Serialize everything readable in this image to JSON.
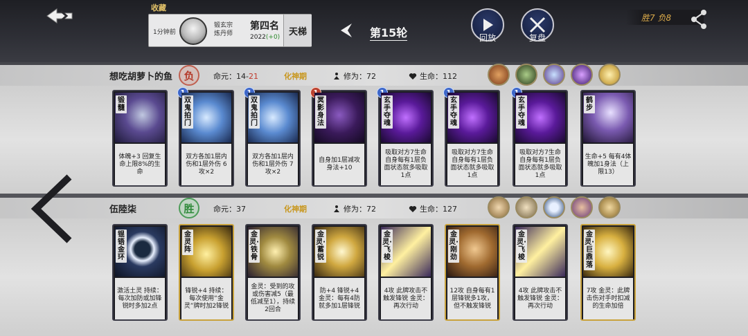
{
  "header": {
    "favorite_label": "收藏",
    "time_ago": "1分钟前",
    "sect_line1": "锻玄宗",
    "sect_line2": "炼丹师",
    "rank": "第四名",
    "score": "2022",
    "score_delta": "(+0)",
    "ladder": "天梯",
    "round": "第15轮",
    "replay_label": "回放",
    "review_label": "复盘",
    "record": "胜7  负8"
  },
  "players": [
    {
      "name": "想吃胡萝卜的鱼",
      "result": "负",
      "life_label": "命元：",
      "life_value": "14",
      "life_sep": "-",
      "life_loss": "21",
      "realm": "化神期",
      "cultivation_label": "修为：",
      "cultivation": "72",
      "hp_label": "生命：",
      "hp": "112",
      "skills": [
        "orange-beast-icon",
        "green-warrior-icon",
        "blue-sword-icon",
        "violet-lightning-icon",
        "golden-sun-icon"
      ],
      "cards": [
        {
          "name": "锻髓",
          "level": "",
          "desc": "体魄+3 回复生命上限8%的生命"
        },
        {
          "name": "双鬼拍门",
          "level": "1",
          "desc": "双方各加1层内伤和1层外伤 6攻×2"
        },
        {
          "name": "双鬼拍门",
          "level": "1",
          "desc": "双方各加1层内伤和1层外伤 7攻×2"
        },
        {
          "name": "冥影身法",
          "level": "1",
          "desc": "自身加1层减攻身法+10"
        },
        {
          "name": "玄手夺魂",
          "level": "1",
          "desc": "吸取对方7生命 自身每有1层负面状态就多吸取1点"
        },
        {
          "name": "玄手夺魂",
          "level": "1",
          "desc": "吸取对方7生命 自身每有1层负面状态就多吸取1点"
        },
        {
          "name": "玄手夺魂",
          "level": "1",
          "desc": "吸取对方7生命 自身每有1层负面状态就多吸取1点"
        },
        {
          "name": "鹤步",
          "level": "",
          "desc": "生命+5 每有4体魄加1身法（上限13）"
        }
      ]
    },
    {
      "name": "伍陸柒",
      "result": "胜",
      "life_label": "命元：",
      "life_value": "37",
      "realm": "化神期",
      "cultivation_label": "修为：",
      "cultivation": "72",
      "hp_label": "生命：",
      "hp": "127",
      "skills": [
        "goat-beast-icon",
        "tiger-beast-icon",
        "blue-ring-icon",
        "purple-tiger-icon",
        "gold-beast-icon"
      ],
      "cards": [
        {
          "name": "锟铻金环",
          "level": "",
          "desc": "激活土灵 持续：每次加防或加锋锐时多加2点"
        },
        {
          "name": "金灵阵",
          "level": "",
          "desc": "锋锐+4 持续：每次使用“金灵”牌时加2锋锐"
        },
        {
          "name": "金灵·铁骨",
          "level": "",
          "desc": "金灵：受到的攻或伤害减5（最低减至1），持续2回合"
        },
        {
          "name": "金灵·蓄锐",
          "level": "",
          "desc": "防+4 锋锐+4 金灵：每有4防就多加1层锋锐"
        },
        {
          "name": "金灵·飞梭",
          "level": "",
          "desc": "4攻 此牌攻击不触发锋锐 金灵：再次行动"
        },
        {
          "name": "金灵·刚劲",
          "level": "",
          "desc": "12攻 自身每有1层锋锐多1攻，但不触发锋锐"
        },
        {
          "name": "金灵·飞梭",
          "level": "",
          "desc": "4攻 此牌攻击不触发锋锐 金灵：再次行动"
        },
        {
          "name": "金灵·巨鼎落",
          "level": "",
          "desc": "7攻 金灵：此牌击伤对手时扣减的生命加倍"
        }
      ]
    }
  ]
}
